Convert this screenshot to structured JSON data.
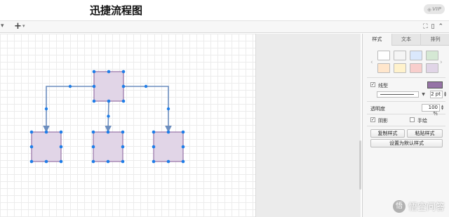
{
  "app": {
    "title": "迅捷流程图",
    "vip_label": "VIP"
  },
  "toolbar": {
    "left_caret": "▾",
    "add_label": "+",
    "add_caret": "▾",
    "right_icons": [
      "⛶",
      "▯",
      "⌃"
    ]
  },
  "format_panel": {
    "tabs": [
      {
        "label": "样式",
        "active": true
      },
      {
        "label": "文本",
        "active": false
      },
      {
        "label": "排列",
        "active": false
      }
    ],
    "swatch_colors": [
      "#ffffff",
      "#f5f5f5",
      "#dae8fc",
      "#d5e8d4",
      "#ffe6cc",
      "#fff2cc",
      "#f8cecc",
      "#e1d5e7"
    ],
    "line": {
      "label": "线型",
      "checked": true,
      "color": "#9673a6",
      "width_value": "2 pt"
    },
    "opacity": {
      "label": "透明度",
      "value": "100 %"
    },
    "shadow": {
      "label": "阴影",
      "checked": true
    },
    "sketch": {
      "label": "手绘",
      "checked": false
    },
    "buttons": {
      "copy_style": "复制样式",
      "paste_style": "粘贴样式",
      "set_default_style": "设置为默认样式"
    }
  },
  "diagram": {
    "shape_fill": "#e1d5e7",
    "shape_stroke": "#9673a6",
    "connector_color": "#6c8ebf",
    "handle_color": "#1e7de8",
    "nodes": [
      {
        "id": "top",
        "label": ""
      },
      {
        "id": "bottom-left",
        "label": ""
      },
      {
        "id": "bottom-center",
        "label": ""
      },
      {
        "id": "bottom-right",
        "label": ""
      }
    ],
    "edges": [
      {
        "from": "top",
        "to": "bottom-left"
      },
      {
        "from": "top",
        "to": "bottom-center"
      },
      {
        "from": "top",
        "to": "bottom-right"
      }
    ]
  },
  "watermark": {
    "text": "悟空问答"
  }
}
